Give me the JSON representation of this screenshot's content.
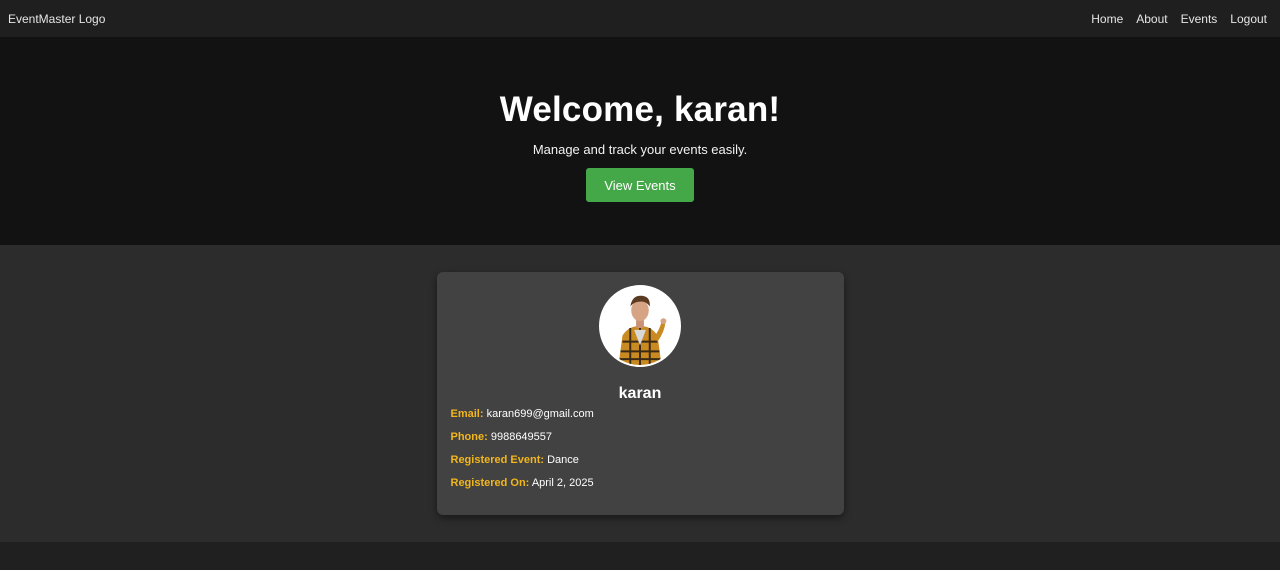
{
  "navbar": {
    "logo_alt": "EventMaster Logo",
    "links": [
      "Home",
      "About",
      "Events",
      "Logout"
    ]
  },
  "hero": {
    "title": "Welcome, karan!",
    "subtitle": "Manage and track your events easily.",
    "button_label": "View Events"
  },
  "profile": {
    "name": "karan",
    "fields": [
      {
        "key": "Email:",
        "value": "karan699@gmail.com"
      },
      {
        "key": "Phone:",
        "value": "9988649557"
      },
      {
        "key": "Registered Event:",
        "value": "Dance"
      },
      {
        "key": "Registered On:",
        "value": "April 2, 2025"
      }
    ]
  },
  "colors": {
    "accent_green": "#45a848",
    "label_gold": "#f2b61c",
    "hero_bg": "#121212",
    "card_bg": "#424242"
  }
}
